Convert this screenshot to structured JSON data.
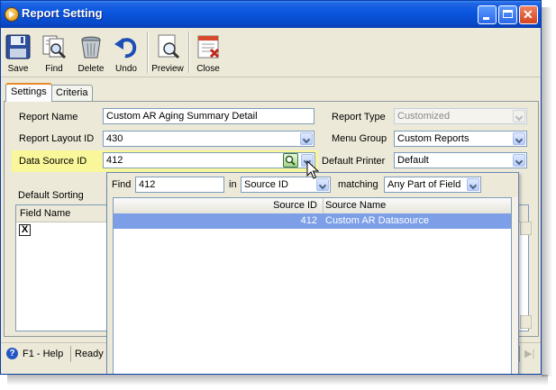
{
  "window": {
    "title": "Report Setting",
    "controls": {
      "minimize": "minimize",
      "maximize": "maximize",
      "close": "close"
    }
  },
  "toolbar": {
    "save_label": "Save",
    "find_label": "Find",
    "delete_label": "Delete",
    "undo_label": "Undo",
    "preview_label": "Preview",
    "close_label": "Close"
  },
  "tabs": [
    "Settings",
    "Criteria"
  ],
  "form": {
    "report_name_label": "Report Name",
    "report_name_value": "Custom AR Aging Summary Detail",
    "report_layout_label": "Report Layout ID",
    "report_layout_value": "430",
    "data_source_label": "Data Source ID",
    "data_source_value": "412",
    "report_type_label": "Report Type",
    "report_type_value": "Customized",
    "menu_group_label": "Menu Group",
    "menu_group_value": "Custom Reports",
    "default_printer_label": "Default Printer",
    "default_printer_value": "Default",
    "default_sorting_label": "Default Sorting",
    "sorting_column_field_name": "Field Name",
    "delete_row_glyph": "X"
  },
  "lookup": {
    "find_label": "Find",
    "find_value": "412",
    "in_label": "in",
    "in_value": "Source ID",
    "matching_label": "matching",
    "matching_value": "Any Part of Field",
    "columns": [
      "Source ID",
      "Source Name"
    ],
    "rows": [
      {
        "source_id": "412",
        "source_name": "Custom AR Datasource"
      }
    ]
  },
  "status": {
    "help": "F1 - Help",
    "state": "Ready"
  },
  "colors": {
    "title_bar": "#0a57df",
    "highlight": "#f9f79a",
    "selected_row": "#7c9fe8",
    "window_face": "#ece9d8"
  },
  "icons": [
    "save-icon",
    "find-icon",
    "delete-icon",
    "undo-icon",
    "preview-icon",
    "close-report-icon",
    "search-icon",
    "chevron-down-icon",
    "help-icon"
  ]
}
